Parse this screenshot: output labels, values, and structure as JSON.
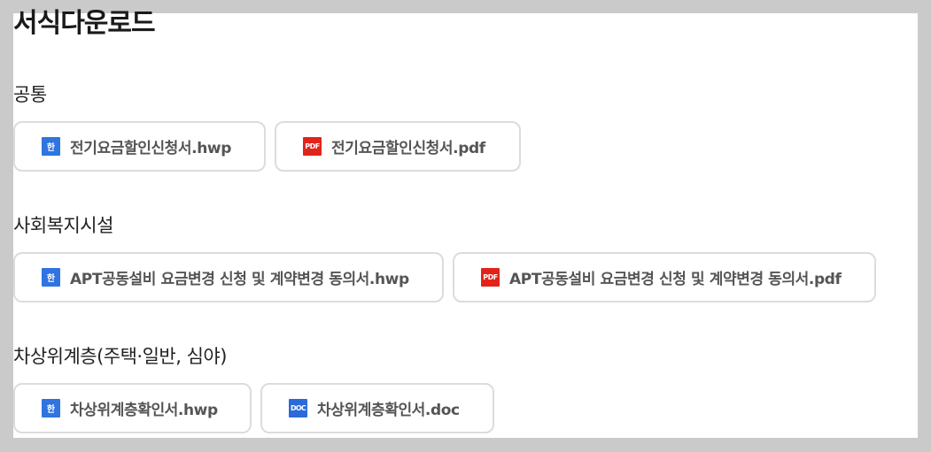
{
  "page": {
    "title": "서식다운로드"
  },
  "sections": [
    {
      "title": "공통",
      "files": [
        {
          "label": "전기요금할인신청서.hwp",
          "icon": "hwp-file-icon",
          "icon_text": "한"
        },
        {
          "label": "전기요금할인신청서.pdf",
          "icon": "pdf-file-icon",
          "icon_text": "PDF"
        }
      ]
    },
    {
      "title": "사회복지시설",
      "files": [
        {
          "label": "APT공동설비 요금변경 신청 및 계약변경 동의서.hwp",
          "icon": "hwp-file-icon",
          "icon_text": "한"
        },
        {
          "label": "APT공동설비 요금변경 신청 및 계약변경 동의서.pdf",
          "icon": "pdf-file-icon",
          "icon_text": "PDF"
        }
      ]
    },
    {
      "title": "차상위계층(주택·일반, 심야)",
      "files": [
        {
          "label": "차상위계층확인서.hwp",
          "icon": "hwp-file-icon",
          "icon_text": "한"
        },
        {
          "label": "차상위계층확인서.doc",
          "icon": "doc-file-icon",
          "icon_text": "DOC"
        }
      ]
    }
  ],
  "colors": {
    "hwp": "#2f74e0",
    "pdf": "#e2231a",
    "doc": "#2a6ad9",
    "border": "#dcdcdc"
  }
}
